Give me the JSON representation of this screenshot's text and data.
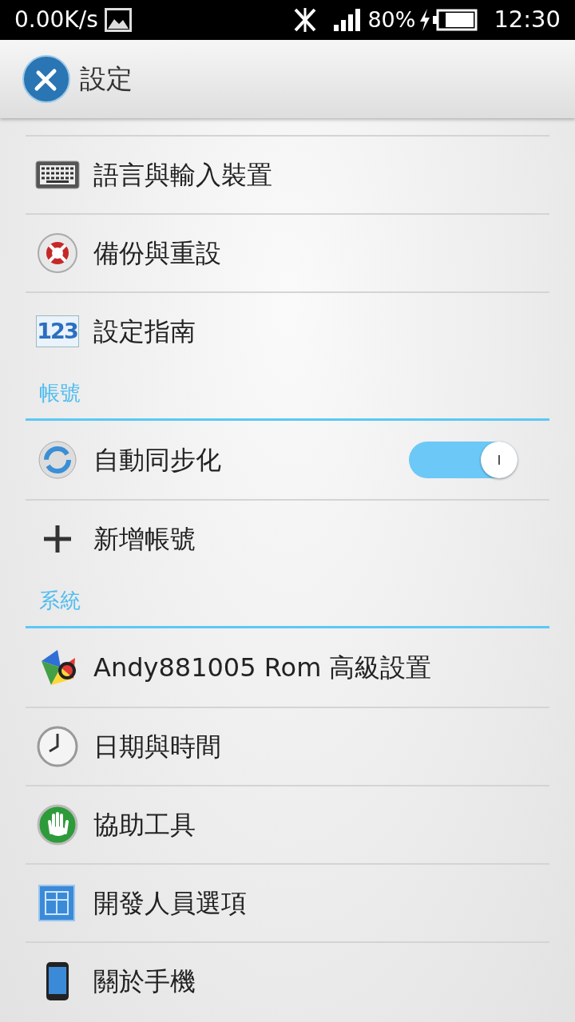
{
  "status_bar": {
    "network_speed": "0.00K/s",
    "battery_percent": "80%",
    "time": "12:30"
  },
  "action_bar": {
    "title": "設定"
  },
  "sections": [
    {
      "items": [
        {
          "label": "語言與輸入裝置",
          "kind": "link"
        },
        {
          "label": "備份與重設",
          "kind": "link"
        },
        {
          "label": "設定指南",
          "kind": "link",
          "icon_text": "123"
        }
      ]
    },
    {
      "header": "帳號",
      "items": [
        {
          "label": "自動同步化",
          "kind": "toggle",
          "on": true
        },
        {
          "label": "新增帳號",
          "kind": "link"
        }
      ]
    },
    {
      "header": "系統",
      "items": [
        {
          "label": "Andy881005 Rom 高級設置",
          "kind": "link"
        },
        {
          "label": "日期與時間",
          "kind": "link"
        },
        {
          "label": "協助工具",
          "kind": "link"
        },
        {
          "label": "開發人員選項",
          "kind": "link"
        },
        {
          "label": "關於手機",
          "kind": "link"
        }
      ]
    }
  ]
}
